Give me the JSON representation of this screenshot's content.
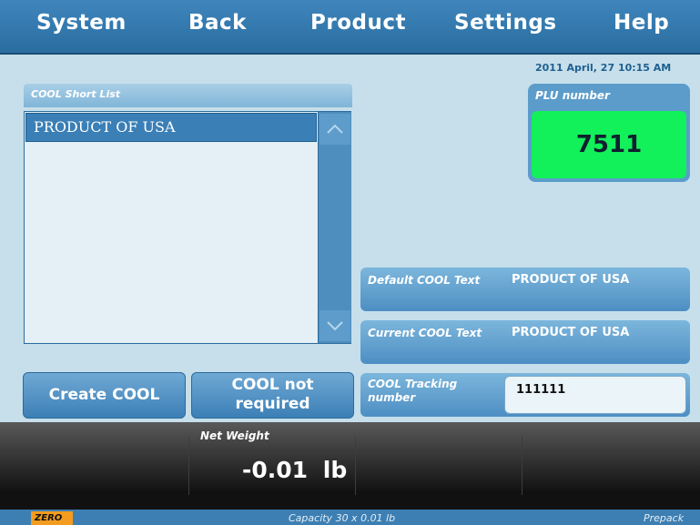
{
  "menu": [
    "System",
    "Back",
    "Product",
    "Settings",
    "Help"
  ],
  "datetime": "2011 April, 27 10:15 AM",
  "cool_list": {
    "header": "COOL Short List",
    "items": [
      "PRODUCT OF USA"
    ],
    "scroll_up_icon": "chevron-up-icon",
    "scroll_down_icon": "chevron-down-icon"
  },
  "buttons": {
    "create_cool": "Create COOL",
    "not_required_line1": "COOL not",
    "not_required_line2": "required"
  },
  "plu": {
    "label": "PLU number",
    "value": "7511",
    "value_color": "#12f05a"
  },
  "default_cool": {
    "label": "Default COOL Text",
    "value": "PRODUCT OF USA"
  },
  "current_cool": {
    "label": "Current COOL Text",
    "value": "PRODUCT OF USA"
  },
  "tracking": {
    "label_line1": "COOL Tracking",
    "label_line2": "number",
    "value": "111111"
  },
  "net_weight": {
    "label": "Net Weight",
    "value": "-0.01",
    "unit": "lb"
  },
  "status_bar": {
    "zero": "ZERO",
    "capacity": "Capacity 30 x 0.01 lb",
    "mode": "Prepack"
  },
  "colors": {
    "menu_bg": "#3f86bd",
    "zero_badge": "#f39c1f"
  }
}
